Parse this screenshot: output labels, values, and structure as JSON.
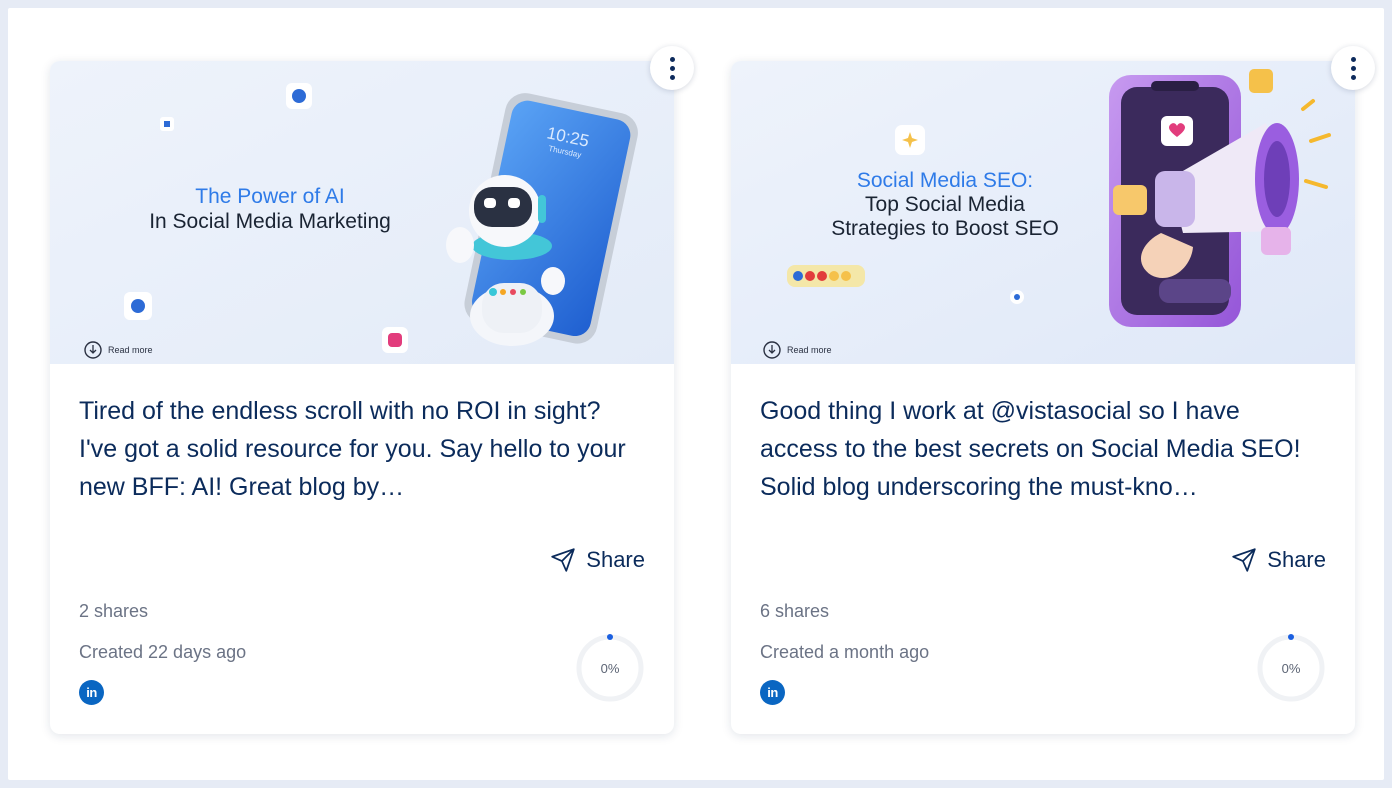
{
  "cards": [
    {
      "image": {
        "title_line1": "The  Power of AI",
        "title_line2": "In Social Media Marketing",
        "read_more": "Read more",
        "phone_time": "10:25",
        "phone_day": "Thursday"
      },
      "caption": "Tired of the endless scroll with no ROI in sight? I've got a solid resource for you. Say hello to your new BFF: AI! Great blog by…",
      "share_label": "Share",
      "shares": "2 shares",
      "created": "Created 22 days ago",
      "network_icon": "in",
      "progress": "0%",
      "progress_value": 0
    },
    {
      "image": {
        "title_line1": "Social Media SEO:",
        "title_line2": "Top Social Media",
        "title_line3": "Strategies to Boost SEO",
        "read_more": "Read more"
      },
      "caption": "Good thing I work at @vistasocial so I have access to the best secrets on Social Media SEO! Solid blog underscoring the must-kno…",
      "share_label": "Share",
      "shares": "6 shares",
      "created": "Created a month ago",
      "network_icon": "in",
      "progress": "0%",
      "progress_value": 0
    }
  ],
  "colors": {
    "text_primary": "#0b2b5b",
    "text_secondary": "#6b7385",
    "accent": "#1a5fe0",
    "linkedin": "#0a66c2"
  }
}
